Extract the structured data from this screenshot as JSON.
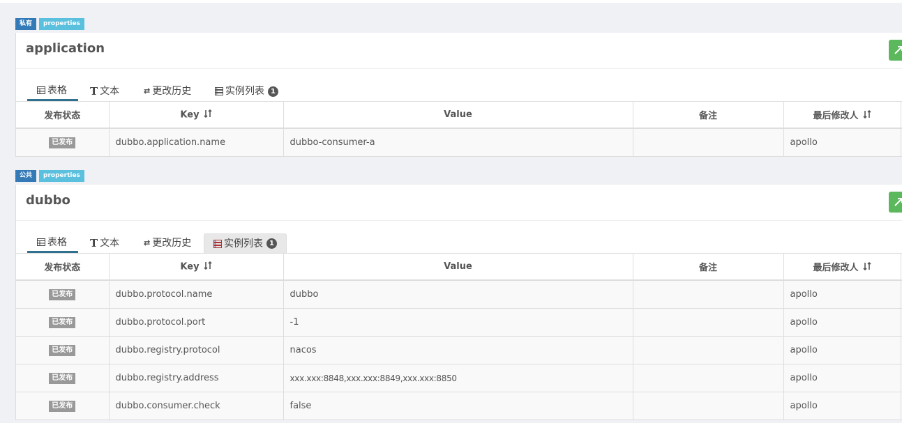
{
  "namespaces": [
    {
      "scope_badge": "私有",
      "format_badge": "properties",
      "name": "application",
      "tabs": [
        "表格",
        "文本",
        "更改历史",
        "实例列表"
      ],
      "instance_count": "1",
      "columns": [
        "发布状态",
        "Key",
        "Value",
        "备注",
        "最后修改人"
      ],
      "rows": [
        {
          "status": "已发布",
          "key": "dubbo.application.name",
          "value": "dubbo-consumer-a",
          "comment": "",
          "modifier": "apollo"
        }
      ]
    },
    {
      "scope_badge": "公共",
      "format_badge": "properties",
      "name": "dubbo",
      "tabs": [
        "表格",
        "文本",
        "更改历史",
        "实例列表"
      ],
      "instance_count": "1",
      "columns": [
        "发布状态",
        "Key",
        "Value",
        "备注",
        "最后修改人"
      ],
      "rows": [
        {
          "status": "已发布",
          "key": "dubbo.protocol.name",
          "value": "dubbo",
          "comment": "",
          "modifier": "apollo"
        },
        {
          "status": "已发布",
          "key": "dubbo.protocol.port",
          "value": "-1",
          "comment": "",
          "modifier": "apollo"
        },
        {
          "status": "已发布",
          "key": "dubbo.registry.protocol",
          "value": "nacos",
          "comment": "",
          "modifier": "apollo"
        },
        {
          "status": "已发布",
          "key": "dubbo.registry.address",
          "value": "xxx.xxx:8848,xxx.xxx:8849,xxx.xxx:8850",
          "comment": "",
          "modifier": "apollo"
        },
        {
          "status": "已发布",
          "key": "dubbo.consumer.check",
          "value": "false",
          "comment": "",
          "modifier": "apollo"
        }
      ]
    }
  ],
  "colors": {
    "scope_badge": "#337ab7",
    "format_badge": "#5bc0de",
    "publish_button": "#5cb85c",
    "published_badge": "#999999",
    "active_tab_underline": "#31708f"
  },
  "icons": {
    "tab_table": "table-icon",
    "tab_text": "text-icon",
    "tab_history": "exchange-icon",
    "tab_instances": "server-list-icon",
    "sort": "sort-icon",
    "publish": "publish-icon"
  }
}
